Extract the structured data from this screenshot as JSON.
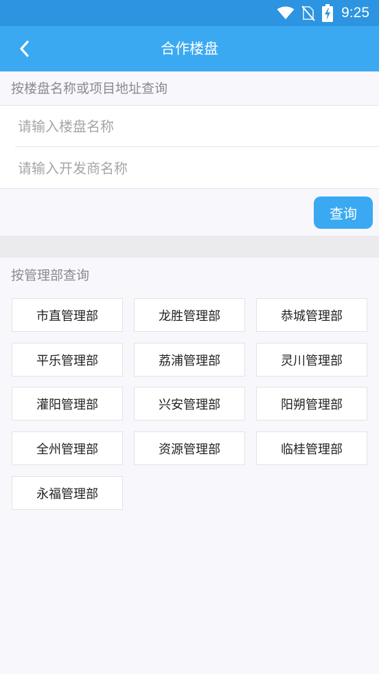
{
  "status_bar": {
    "time": "9:25",
    "icons": [
      "wifi-icon",
      "no-sim-icon",
      "battery-charging-icon"
    ]
  },
  "app_bar": {
    "title": "合作楼盘",
    "back_icon": "chevron-left-icon"
  },
  "search_by_name": {
    "label": "按楼盘名称或项目地址查询",
    "property_input": {
      "value": "",
      "placeholder": "请输入楼盘名称"
    },
    "developer_input": {
      "value": "",
      "placeholder": "请输入开发商名称"
    },
    "query_button": "查询"
  },
  "search_by_department": {
    "label": "按管理部查询",
    "departments": [
      "市直管理部",
      "龙胜管理部",
      "恭城管理部",
      "平乐管理部",
      "荔浦管理部",
      "灵川管理部",
      "灌阳管理部",
      "兴安管理部",
      "阳朔管理部",
      "全州管理部",
      "资源管理部",
      "临桂管理部",
      "永福管理部"
    ]
  },
  "colors": {
    "status_bar": "#2c94e0",
    "app_bar": "#3aa9f2",
    "background": "#f8f7fc",
    "divider_band": "#ebebee"
  }
}
